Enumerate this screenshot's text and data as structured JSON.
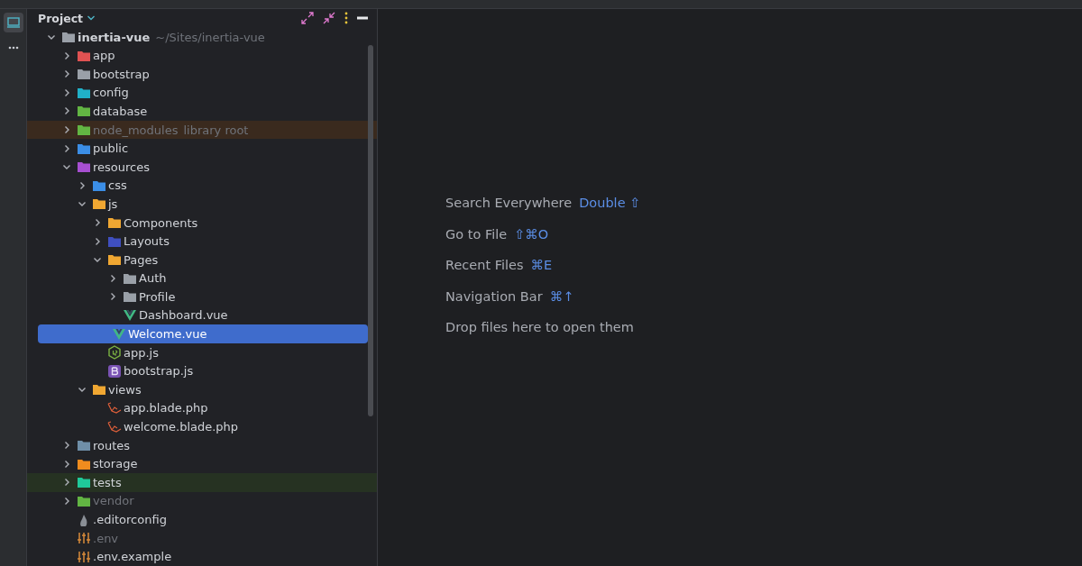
{
  "tool_strip": {
    "items": [
      {
        "kind": "project",
        "selected": true
      },
      {
        "kind": "more",
        "selected": false
      }
    ]
  },
  "project_panel": {
    "title": "Project",
    "tree": [
      {
        "label": "inertia-vue",
        "note": "~/Sites/inertia-vue",
        "kind": "folder",
        "color": "#9aa0a8",
        "expanded": true,
        "selected": false,
        "dimmed": false,
        "library": false,
        "test_root": false,
        "children": [
          {
            "label": "app",
            "kind": "folder",
            "color": "#e05252",
            "expanded": false,
            "selected": false,
            "dimmed": false,
            "library": false,
            "test_root": false
          },
          {
            "label": "bootstrap",
            "kind": "folder",
            "color": "#9aa0a8",
            "expanded": false,
            "selected": false,
            "dimmed": false,
            "library": false,
            "test_root": false
          },
          {
            "label": "config",
            "kind": "folder",
            "color": "#20b0c8",
            "expanded": false,
            "selected": false,
            "dimmed": false,
            "library": false,
            "test_root": false
          },
          {
            "label": "database",
            "kind": "folder",
            "color": "#62b543",
            "expanded": false,
            "selected": false,
            "dimmed": false,
            "library": false,
            "test_root": false
          },
          {
            "label": "node_modules",
            "note": "library root",
            "kind": "folder",
            "color": "#62b543",
            "expanded": false,
            "selected": false,
            "dimmed": true,
            "library": true,
            "test_root": false
          },
          {
            "label": "public",
            "kind": "folder",
            "color": "#3b8ee6",
            "expanded": false,
            "selected": false,
            "dimmed": false,
            "library": false,
            "test_root": false
          },
          {
            "label": "resources",
            "kind": "folder",
            "color": "#a74fd1",
            "expanded": true,
            "selected": false,
            "dimmed": false,
            "library": false,
            "test_root": false,
            "children": [
              {
                "label": "css",
                "kind": "folder",
                "color": "#3b8ee6",
                "expanded": false,
                "selected": false,
                "dimmed": false,
                "library": false,
                "test_root": false
              },
              {
                "label": "js",
                "kind": "folder",
                "color": "#f0a732",
                "expanded": true,
                "selected": false,
                "dimmed": false,
                "library": false,
                "test_root": false,
                "children": [
                  {
                    "label": "Components",
                    "kind": "folder",
                    "color": "#f0a732",
                    "expanded": false,
                    "selected": false,
                    "dimmed": false,
                    "library": false,
                    "test_root": false
                  },
                  {
                    "label": "Layouts",
                    "kind": "folder",
                    "color": "#3f4fc0",
                    "expanded": false,
                    "selected": false,
                    "dimmed": false,
                    "library": false,
                    "test_root": false
                  },
                  {
                    "label": "Pages",
                    "kind": "folder",
                    "color": "#f0a732",
                    "expanded": true,
                    "selected": false,
                    "dimmed": false,
                    "library": false,
                    "test_root": false,
                    "children": [
                      {
                        "label": "Auth",
                        "kind": "folder",
                        "color": "#9aa0a8",
                        "expanded": false,
                        "selected": false,
                        "dimmed": false,
                        "library": false,
                        "test_root": false
                      },
                      {
                        "label": "Profile",
                        "kind": "folder",
                        "color": "#9aa0a8",
                        "expanded": false,
                        "selected": false,
                        "dimmed": false,
                        "library": false,
                        "test_root": false
                      },
                      {
                        "label": "Dashboard.vue",
                        "kind": "vue",
                        "selected": false,
                        "dimmed": false,
                        "library": false,
                        "test_root": false
                      },
                      {
                        "label": "Welcome.vue",
                        "kind": "vue",
                        "selected": true,
                        "dimmed": false,
                        "library": false,
                        "test_root": false
                      }
                    ]
                  },
                  {
                    "label": "app.js",
                    "kind": "js",
                    "selected": false,
                    "dimmed": false,
                    "library": false,
                    "test_root": false
                  },
                  {
                    "label": "bootstrap.js",
                    "kind": "bootstrap",
                    "selected": false,
                    "dimmed": false,
                    "library": false,
                    "test_root": false
                  }
                ]
              },
              {
                "label": "views",
                "kind": "folder",
                "color": "#f0a732",
                "expanded": true,
                "selected": false,
                "dimmed": false,
                "library": false,
                "test_root": false,
                "children": [
                  {
                    "label": "app.blade.php",
                    "kind": "blade",
                    "selected": false,
                    "dimmed": false,
                    "library": false,
                    "test_root": false
                  },
                  {
                    "label": "welcome.blade.php",
                    "kind": "blade",
                    "selected": false,
                    "dimmed": false,
                    "library": false,
                    "test_root": false
                  }
                ]
              }
            ]
          },
          {
            "label": "routes",
            "kind": "folder",
            "color": "#6f8fa8",
            "expanded": false,
            "selected": false,
            "dimmed": false,
            "library": false,
            "test_root": false
          },
          {
            "label": "storage",
            "kind": "folder",
            "color": "#f08c1e",
            "expanded": false,
            "selected": false,
            "dimmed": false,
            "library": false,
            "test_root": false
          },
          {
            "label": "tests",
            "kind": "folder",
            "color": "#1fc99a",
            "expanded": false,
            "selected": false,
            "dimmed": false,
            "library": false,
            "test_root": true
          },
          {
            "label": "vendor",
            "kind": "folder",
            "color": "#62b543",
            "expanded": false,
            "selected": false,
            "dimmed": true,
            "library": false,
            "test_root": false
          },
          {
            "label": ".editorconfig",
            "kind": "editorconfig",
            "selected": false,
            "dimmed": false,
            "library": false,
            "test_root": false
          },
          {
            "label": ".env",
            "kind": "env",
            "selected": false,
            "dimmed": true,
            "library": false,
            "test_root": false
          },
          {
            "label": ".env.example",
            "kind": "env",
            "selected": false,
            "dimmed": false,
            "library": false,
            "test_root": false
          }
        ]
      }
    ]
  },
  "editor_empty_state": {
    "hints": [
      {
        "label": "Search Everywhere",
        "shortcut": "Double ⇧"
      },
      {
        "label": "Go to File",
        "shortcut": "⇧⌘O"
      },
      {
        "label": "Recent Files",
        "shortcut": "⌘E"
      },
      {
        "label": "Navigation Bar",
        "shortcut": "⌘↑"
      },
      {
        "label": "Drop files here to open them"
      }
    ]
  }
}
